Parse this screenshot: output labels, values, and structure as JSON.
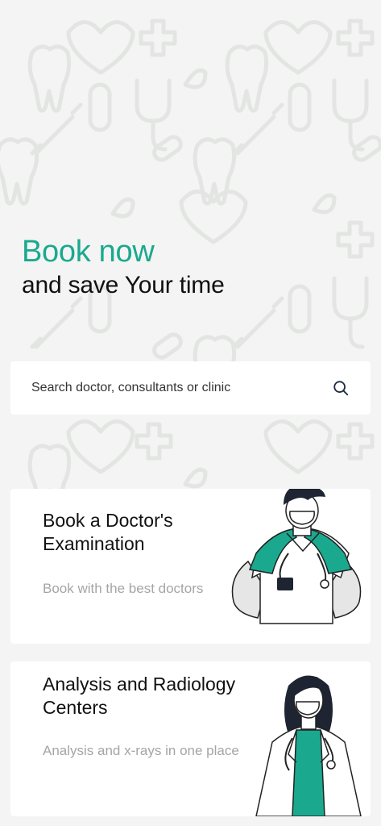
{
  "hero": {
    "accent": "Book now",
    "subtitle": "and save Your time"
  },
  "search": {
    "placeholder": "Search doctor, consultants or clinic",
    "icon": "search-icon"
  },
  "cards": [
    {
      "title": "Book a Doctor's Examination",
      "subtitle": "Book with the best doctors",
      "illustration": "male-doctor-illustration"
    },
    {
      "title": "Analysis and Radiology Centers",
      "subtitle": "Analysis and x-rays in one place",
      "illustration": "female-doctor-illustration"
    }
  ],
  "colors": {
    "accent": "#1aa98f",
    "background": "#f3f4f3",
    "card": "#ffffff",
    "muted_text": "#a5a5a5"
  }
}
